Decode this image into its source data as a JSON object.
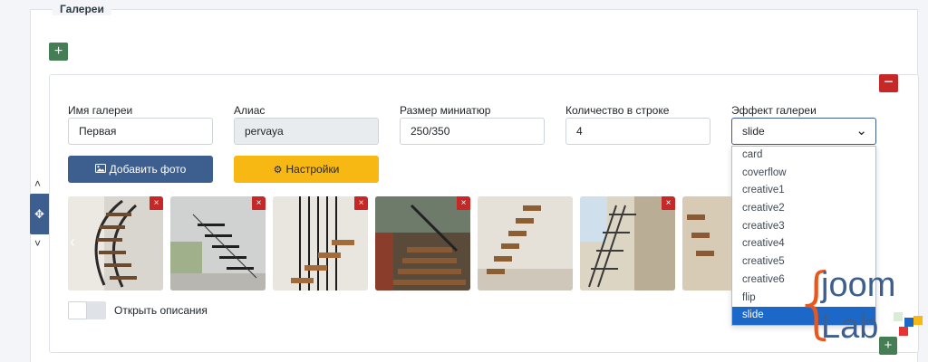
{
  "section": {
    "legend": "Галереи"
  },
  "buttons": {
    "add_top": "+",
    "remove_gallery": "−",
    "add_photo": "Добавить фото",
    "settings": "Настройки",
    "add_bottom": "+"
  },
  "side": {
    "up": "˄",
    "handle": "✥",
    "down": "˅"
  },
  "fields": {
    "name": {
      "label": "Имя галереи",
      "value": "Первая"
    },
    "alias": {
      "label": "Алиас",
      "value": "pervaya"
    },
    "thumb_size": {
      "label": "Размер миниатюр",
      "value": "250/350"
    },
    "per_row": {
      "label": "Количество в строке",
      "value": "4"
    },
    "effect": {
      "label": "Эффект галереи",
      "value": "slide",
      "options": [
        "card",
        "coverflow",
        "creative1",
        "creative2",
        "creative3",
        "creative4",
        "creative5",
        "creative6",
        "flip",
        "slide"
      ],
      "selected_index": 9
    }
  },
  "photos": {
    "delete_label": "×",
    "count_visible": 7,
    "nav_prev": "‹"
  },
  "toggle": {
    "label": "Открыть описания",
    "checked": false
  },
  "logo": {
    "top": "joom",
    "bottom": "Lab"
  },
  "colors": {
    "primary": "#3c5f8f",
    "warning": "#f8b814",
    "success": "#457d54",
    "danger": "#c52827",
    "dropdown_selected": "#1c68c8",
    "logo_orange": "#e8571e"
  }
}
